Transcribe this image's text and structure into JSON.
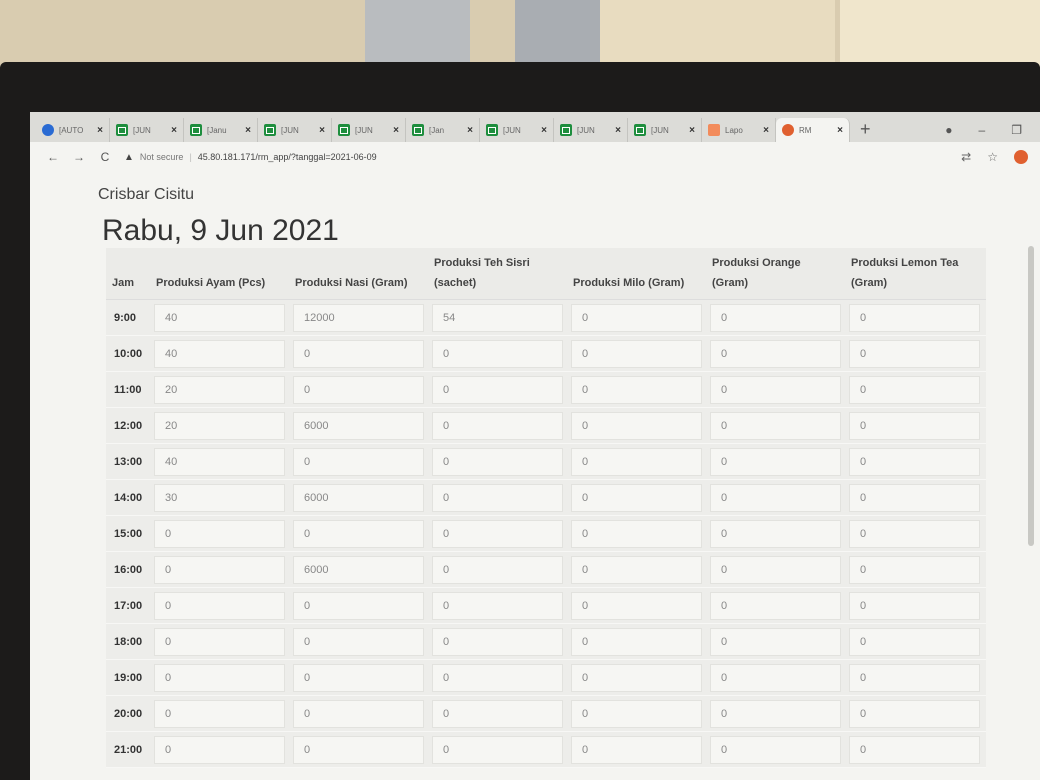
{
  "browser": {
    "tabs": [
      {
        "title": "[AUTO",
        "icon": "chrome-icon"
      },
      {
        "title": "[JUN",
        "icon": "sheets-icon"
      },
      {
        "title": "[Janu",
        "icon": "sheets-icon"
      },
      {
        "title": "[JUN",
        "icon": "sheets-icon"
      },
      {
        "title": "[JUN",
        "icon": "sheets-icon"
      },
      {
        "title": "[Jan",
        "icon": "sheets-icon"
      },
      {
        "title": "[JUN",
        "icon": "sheets-icon"
      },
      {
        "title": "[JUN",
        "icon": "sheets-icon"
      },
      {
        "title": "[JUN",
        "icon": "sheets-icon"
      },
      {
        "title": "Lapo",
        "icon": "slides-icon"
      },
      {
        "title": "RM",
        "icon": "app-icon"
      }
    ],
    "address": {
      "security_label": "Not secure",
      "url": "45.80.181.171/rm_app/?tanggal=2021-06-09"
    }
  },
  "page": {
    "store_name": "Crisbar Cisitu",
    "date_title": "Rabu, 9 Jun 2021"
  },
  "table": {
    "headers": [
      "Jam",
      "Produksi Ayam (Pcs)",
      "Produksi Nasi (Gram)",
      "Produksi Teh Sisri (sachet)",
      "Produksi Milo (Gram)",
      "Produksi Orange (Gram)",
      "Produksi Lemon Tea (Gram)"
    ],
    "rows": [
      {
        "jam": "9:00",
        "values": [
          "40",
          "12000",
          "54",
          "0",
          "0",
          "0"
        ]
      },
      {
        "jam": "10:00",
        "values": [
          "40",
          "0",
          "0",
          "0",
          "0",
          "0"
        ]
      },
      {
        "jam": "11:00",
        "values": [
          "20",
          "0",
          "0",
          "0",
          "0",
          "0"
        ]
      },
      {
        "jam": "12:00",
        "values": [
          "20",
          "6000",
          "0",
          "0",
          "0",
          "0"
        ]
      },
      {
        "jam": "13:00",
        "values": [
          "40",
          "0",
          "0",
          "0",
          "0",
          "0"
        ]
      },
      {
        "jam": "14:00",
        "values": [
          "30",
          "6000",
          "0",
          "0",
          "0",
          "0"
        ]
      },
      {
        "jam": "15:00",
        "values": [
          "0",
          "0",
          "0",
          "0",
          "0",
          "0"
        ]
      },
      {
        "jam": "16:00",
        "values": [
          "0",
          "6000",
          "0",
          "0",
          "0",
          "0"
        ]
      },
      {
        "jam": "17:00",
        "values": [
          "0",
          "0",
          "0",
          "0",
          "0",
          "0"
        ]
      },
      {
        "jam": "18:00",
        "values": [
          "0",
          "0",
          "0",
          "0",
          "0",
          "0"
        ]
      },
      {
        "jam": "19:00",
        "values": [
          "0",
          "0",
          "0",
          "0",
          "0",
          "0"
        ]
      },
      {
        "jam": "20:00",
        "values": [
          "0",
          "0",
          "0",
          "0",
          "0",
          "0"
        ]
      },
      {
        "jam": "21:00",
        "values": [
          "0",
          "0",
          "0",
          "0",
          "0",
          "0"
        ]
      }
    ]
  }
}
